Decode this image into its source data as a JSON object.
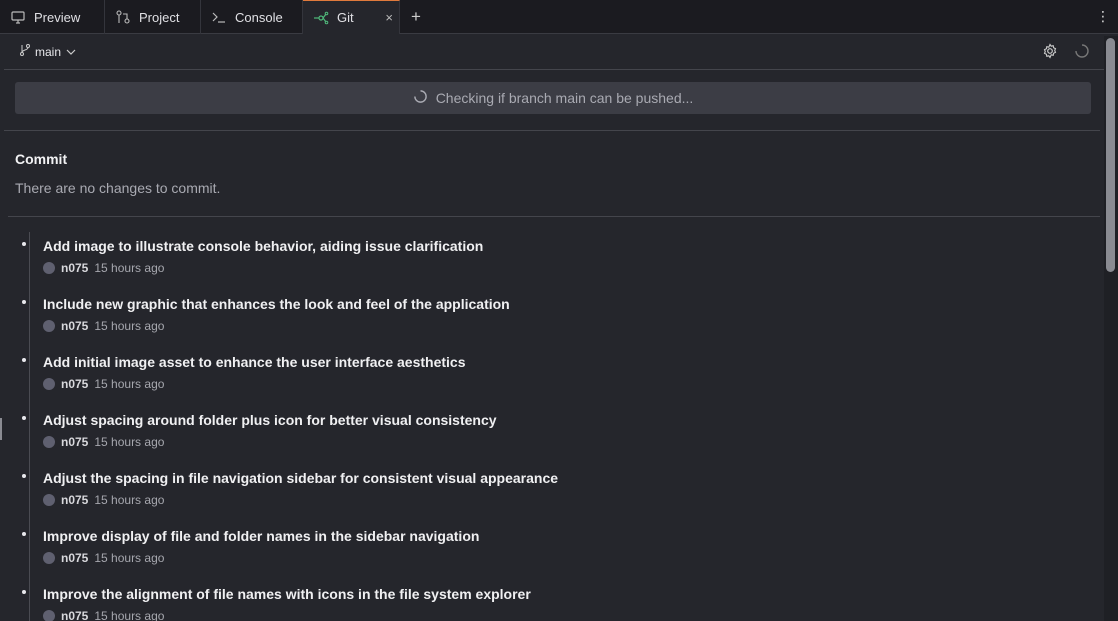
{
  "tabs": [
    {
      "label": "Preview",
      "icon": "monitor-icon"
    },
    {
      "label": "Project",
      "icon": "branch-compare-icon"
    },
    {
      "label": "Console",
      "icon": "terminal-icon"
    },
    {
      "label": "Git",
      "icon": "git-icon",
      "active": true
    }
  ],
  "close_symbol": "×",
  "add_tab_symbol": "+",
  "more_symbol": "⋮",
  "branch": {
    "name": "main",
    "chevron": "chevron-down-icon"
  },
  "push_status": "Checking if branch main can be pushed...",
  "commit_section": {
    "title": "Commit",
    "message": "There are no changes to commit."
  },
  "commits": [
    {
      "message": "Add image to illustrate console behavior, aiding issue clarification",
      "author": "n075",
      "time": "15 hours ago"
    },
    {
      "message": "Include new graphic that enhances the look and feel of the application",
      "author": "n075",
      "time": "15 hours ago"
    },
    {
      "message": "Add initial image asset to enhance the user interface aesthetics",
      "author": "n075",
      "time": "15 hours ago"
    },
    {
      "message": "Adjust spacing around folder plus icon for better visual consistency",
      "author": "n075",
      "time": "15 hours ago"
    },
    {
      "message": "Adjust the spacing in file navigation sidebar for consistent visual appearance",
      "author": "n075",
      "time": "15 hours ago"
    },
    {
      "message": "Improve display of file and folder names in the sidebar navigation",
      "author": "n075",
      "time": "15 hours ago"
    },
    {
      "message": "Improve the alignment of file names with icons in the file system explorer",
      "author": "n075",
      "time": "15 hours ago"
    }
  ],
  "colors": {
    "background": "#25262c",
    "tabbar": "#1b1b20",
    "active_tab_accent": "#e07a3c",
    "git_icon": "#4fb87a"
  }
}
